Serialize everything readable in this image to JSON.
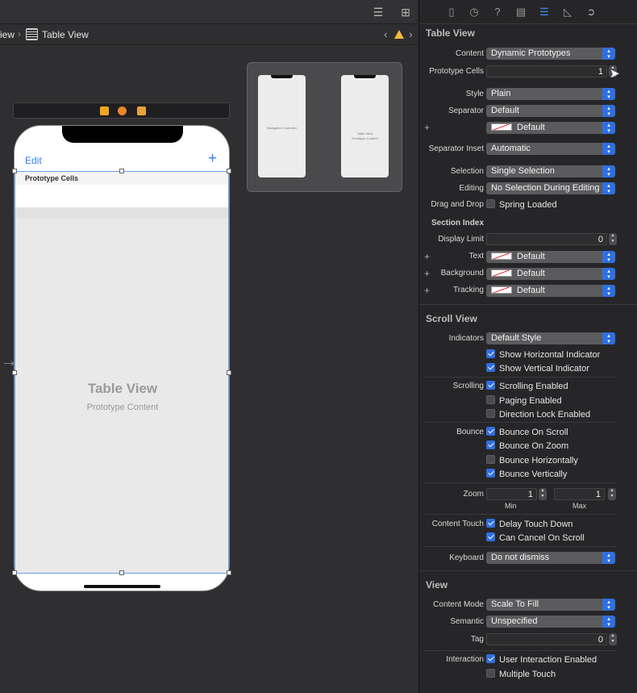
{
  "breadcrumb": {
    "prev": "iew",
    "current": "Table View"
  },
  "canvas": {
    "nav_edit": "Edit",
    "nav_plus": "+",
    "prototype_header": "Prototype Cells",
    "table_title": "Table View",
    "table_subtitle": "Prototype Content",
    "mini_nav_text": "Navigation Controller",
    "mini_table_text": "Table View",
    "mini_table_sub": "Prototype Content"
  },
  "inspector": {
    "table_view": {
      "title": "Table View",
      "content_label": "Content",
      "content_value": "Dynamic Prototypes",
      "prototype_cells_label": "Prototype Cells",
      "prototype_cells_value": "1",
      "style_label": "Style",
      "style_value": "Plain",
      "separator_label": "Separator",
      "separator_value": "Default",
      "separator_color_value": "Default",
      "separator_inset_label": "Separator Inset",
      "separator_inset_value": "Automatic",
      "selection_label": "Selection",
      "selection_value": "Single Selection",
      "editing_label": "Editing",
      "editing_value": "No Selection During Editing",
      "drag_drop_label": "Drag and Drop",
      "spring_loaded": "Spring Loaded",
      "section_index": "Section Index",
      "display_limit_label": "Display Limit",
      "display_limit_value": "0",
      "text_label": "Text",
      "text_value": "Default",
      "background_label": "Background",
      "background_value": "Default",
      "tracking_label": "Tracking",
      "tracking_value": "Default"
    },
    "scroll_view": {
      "title": "Scroll View",
      "indicators_label": "Indicators",
      "indicators_value": "Default Style",
      "show_horizontal": "Show Horizontal Indicator",
      "show_vertical": "Show Vertical Indicator",
      "scrolling_label": "Scrolling",
      "scrolling_enabled": "Scrolling Enabled",
      "paging_enabled": "Paging Enabled",
      "direction_lock": "Direction Lock Enabled",
      "bounce_label": "Bounce",
      "bounce_on_scroll": "Bounce On Scroll",
      "bounce_on_zoom": "Bounce On Zoom",
      "bounce_horizontally": "Bounce Horizontally",
      "bounce_vertically": "Bounce Vertically",
      "zoom_label": "Zoom",
      "zoom_min": "1",
      "zoom_max": "1",
      "min_caption": "Min",
      "max_caption": "Max",
      "content_touch_label": "Content Touch",
      "delay_touch_down": "Delay Touch Down",
      "can_cancel": "Can Cancel On Scroll",
      "keyboard_label": "Keyboard",
      "keyboard_value": "Do not dismiss"
    },
    "view": {
      "title": "View",
      "content_mode_label": "Content Mode",
      "content_mode_value": "Scale To Fill",
      "semantic_label": "Semantic",
      "semantic_value": "Unspecified",
      "tag_label": "Tag",
      "tag_value": "0",
      "interaction_label": "Interaction",
      "user_interaction": "User Interaction Enabled",
      "multiple_touch": "Multiple Touch"
    }
  },
  "colors": {
    "accent": "#2f6fe0",
    "warning": "#f1b93b",
    "ios_blue": "#2f7ff5"
  }
}
